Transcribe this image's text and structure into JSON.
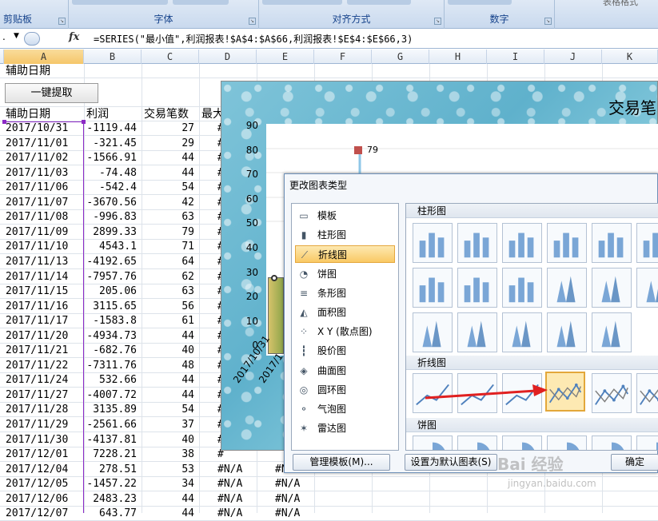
{
  "ribbon": {
    "groups": [
      "剪贴板",
      "字体",
      "对齐方式",
      "数字"
    ],
    "corner_text": "表格格式"
  },
  "formula_bar": {
    "name_box": ".",
    "fx": "fx",
    "formula": "=SERIES(\"最小值\",利润报表!$A$4:$A$66,利润报表!$E$4:$E$66,3)"
  },
  "columns": [
    "A",
    "B",
    "C",
    "D",
    "E",
    "F",
    "G",
    "H",
    "I",
    "J",
    "K"
  ],
  "sheet": {
    "a1": "辅助日期",
    "button_label": "一键提取",
    "headers": [
      "辅助日期",
      "利润",
      "交易笔数",
      "最大"
    ],
    "rows": [
      [
        "2017/10/31",
        "-1119.44",
        "27",
        "#"
      ],
      [
        "2017/11/01",
        "-321.45",
        "29",
        "#"
      ],
      [
        "2017/11/02",
        "-1566.91",
        "44",
        "#"
      ],
      [
        "2017/11/03",
        "-74.48",
        "44",
        "#"
      ],
      [
        "2017/11/06",
        "-542.4",
        "54",
        "#"
      ],
      [
        "2017/11/07",
        "-3670.56",
        "42",
        "#"
      ],
      [
        "2017/11/08",
        "-996.83",
        "63",
        "#"
      ],
      [
        "2017/11/09",
        "2899.33",
        "79",
        "#"
      ],
      [
        "2017/11/10",
        "4543.1",
        "71",
        "#"
      ],
      [
        "2017/11/13",
        "-4192.65",
        "64",
        "#"
      ],
      [
        "2017/11/14",
        "-7957.76",
        "62",
        "#"
      ],
      [
        "2017/11/15",
        "205.06",
        "63",
        "#"
      ],
      [
        "2017/11/16",
        "3115.65",
        "56",
        "#"
      ],
      [
        "2017/11/17",
        "-1583.8",
        "61",
        "#"
      ],
      [
        "2017/11/20",
        "-4934.73",
        "44",
        "#"
      ],
      [
        "2017/11/21",
        "-682.76",
        "40",
        "#"
      ],
      [
        "2017/11/22",
        "-7311.76",
        "48",
        "#"
      ],
      [
        "2017/11/24",
        "532.66",
        "44",
        "#"
      ],
      [
        "2017/11/27",
        "-4007.72",
        "44",
        "#"
      ],
      [
        "2017/11/28",
        "3135.89",
        "54",
        "#"
      ],
      [
        "2017/11/29",
        "-2561.66",
        "37",
        "#"
      ],
      [
        "2017/11/30",
        "-4137.81",
        "40",
        "#"
      ],
      [
        "2017/12/01",
        "7228.21",
        "38",
        "#"
      ],
      [
        "2017/12/04",
        "278.51",
        "53",
        "#N/A",
        "#N"
      ],
      [
        "2017/12/05",
        "-1457.22",
        "34",
        "#N/A",
        "#N/A"
      ],
      [
        "2017/12/06",
        "2483.23",
        "44",
        "#N/A",
        "#N/A"
      ],
      [
        "2017/12/07",
        "643.77",
        "44",
        "#N/A",
        "#N/A"
      ]
    ]
  },
  "chart": {
    "title": "交易笔",
    "y_ticks": [
      "90",
      "80",
      "70",
      "60",
      "50",
      "40",
      "30",
      "20",
      "10",
      "0"
    ],
    "point_label": "79",
    "x_labels": [
      "2017/10/31",
      "2017/1"
    ]
  },
  "dialog": {
    "title": "更改图表类型",
    "categories": [
      {
        "label": "模板",
        "icon": "folder-icon"
      },
      {
        "label": "柱形图",
        "icon": "column-chart-icon"
      },
      {
        "label": "折线图",
        "icon": "line-chart-icon"
      },
      {
        "label": "饼图",
        "icon": "pie-chart-icon"
      },
      {
        "label": "条形图",
        "icon": "bar-chart-icon"
      },
      {
        "label": "面积图",
        "icon": "area-chart-icon"
      },
      {
        "label": "X Y (散点图)",
        "icon": "scatter-chart-icon"
      },
      {
        "label": "股价图",
        "icon": "stock-chart-icon"
      },
      {
        "label": "曲面图",
        "icon": "surface-chart-icon"
      },
      {
        "label": "圆环图",
        "icon": "doughnut-chart-icon"
      },
      {
        "label": "气泡图",
        "icon": "bubble-chart-icon"
      },
      {
        "label": "雷达图",
        "icon": "radar-chart-icon"
      }
    ],
    "selected_category": "折线图",
    "sections": [
      "柱形图",
      "折线图",
      "饼图"
    ],
    "manage_templates_button": "管理模板(M)...",
    "set_default_button": "设置为默认图表(S)",
    "ok_button": "确定"
  },
  "watermark": {
    "text": "Bai 经验",
    "sub": "jingyan.baidu.com"
  }
}
